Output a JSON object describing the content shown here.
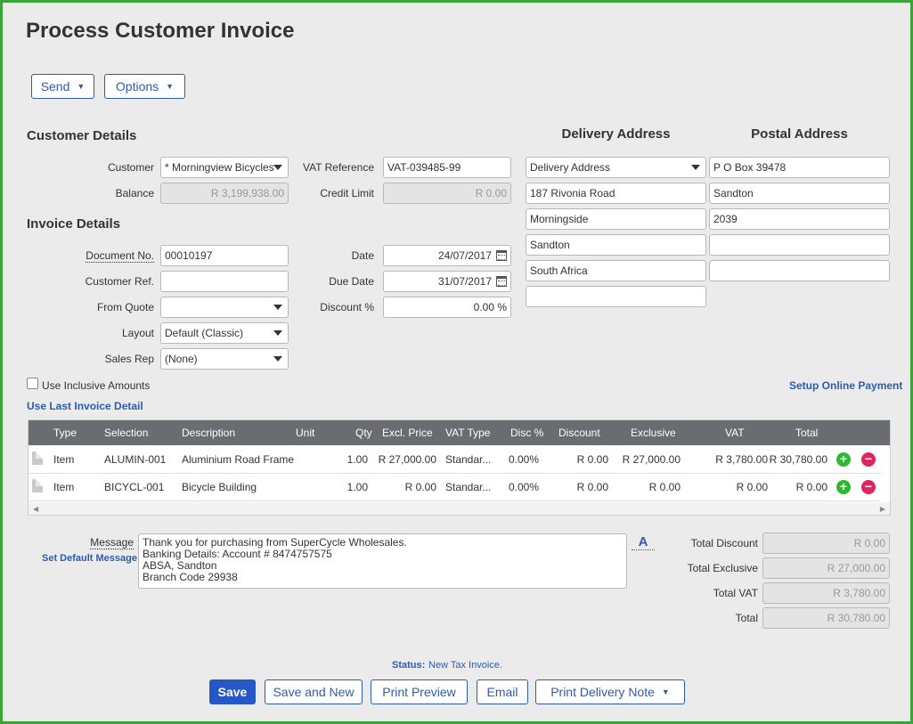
{
  "page": {
    "title": "Process Customer Invoice"
  },
  "toolbar": {
    "send_label": "Send",
    "options_label": "Options"
  },
  "customer_details": {
    "heading": "Customer Details",
    "customer_label": "Customer",
    "customer_value": "* Morningview Bicycles",
    "balance_label": "Balance",
    "balance_value": "R 3,199,938.00",
    "vat_ref_label": "VAT Reference",
    "vat_ref_value": "VAT-039485-99",
    "credit_limit_label": "Credit Limit",
    "credit_limit_value": "R 0.00"
  },
  "invoice_details": {
    "heading": "Invoice Details",
    "doc_no_label": "Document No.",
    "doc_no_value": "00010197",
    "customer_ref_label": "Customer Ref.",
    "customer_ref_value": "",
    "from_quote_label": "From Quote",
    "from_quote_value": "",
    "layout_label": "Layout",
    "layout_value": "Default (Classic)",
    "sales_rep_label": "Sales Rep",
    "sales_rep_value": "(None)",
    "date_label": "Date",
    "date_value": "24/07/2017",
    "due_date_label": "Due Date",
    "due_date_value": "31/07/2017",
    "discount_label": "Discount %",
    "discount_value": "0.00 %"
  },
  "delivery_address": {
    "heading": "Delivery Address",
    "select_value": "Delivery Address",
    "lines": [
      "187 Rivonia Road",
      "Morningside",
      "Sandton",
      "South Africa",
      ""
    ]
  },
  "postal_address": {
    "heading": "Postal Address",
    "lines": [
      "P O Box 39478",
      "Sandton",
      "2039",
      "",
      ""
    ]
  },
  "options": {
    "inclusive_label": "Use Inclusive Amounts",
    "inclusive_checked": false,
    "setup_payment_link": "Setup Online Payment",
    "last_invoice_link": "Use Last Invoice Detail"
  },
  "grid": {
    "columns": [
      "Type",
      "Selection",
      "Description",
      "Unit",
      "Qty",
      "Excl. Price",
      "VAT Type",
      "Disc %",
      "Discount",
      "Exclusive",
      "VAT",
      "Total"
    ],
    "rows": [
      {
        "type": "Item",
        "selection": "ALUMIN-001",
        "description": "Aluminium Road Frame",
        "unit": "",
        "qty": "1.00",
        "excl_price": "R 27,000.00",
        "vat_type": "Standar...",
        "disc_pct": "0.00%",
        "discount": "R 0.00",
        "exclusive": "R 27,000.00",
        "vat": "R 3,780.00",
        "total": "R 30,780.00"
      },
      {
        "type": "Item",
        "selection": "BICYCL-001",
        "description": "Bicycle Building",
        "unit": "",
        "qty": "1.00",
        "excl_price": "R 0.00",
        "vat_type": "Standar...",
        "disc_pct": "0.00%",
        "discount": "R 0.00",
        "exclusive": "R 0.00",
        "vat": "R 0.00",
        "total": "R 0.00"
      }
    ]
  },
  "message": {
    "label": "Message",
    "set_default_link": "Set Default Message",
    "lines": [
      "Thank you for purchasing from SuperCycle Wholesales.",
      "Banking Details:  Account # 8474757575",
      "ABSA, Sandton",
      "Branch Code 29938"
    ],
    "format_button": "A"
  },
  "totals": {
    "total_discount_label": "Total Discount",
    "total_discount_value": "R 0.00",
    "total_exclusive_label": "Total Exclusive",
    "total_exclusive_value": "R 27,000.00",
    "total_vat_label": "Total VAT",
    "total_vat_value": "R 3,780.00",
    "total_label": "Total",
    "total_value": "R 30,780.00"
  },
  "status": {
    "label": "Status:",
    "value": "New Tax Invoice."
  },
  "actions": {
    "save": "Save",
    "save_and_new": "Save and New",
    "print_preview": "Print Preview",
    "email": "Email",
    "print_delivery_note": "Print Delivery Note"
  },
  "colors": {
    "frame": "#3aa33a",
    "accent": "#2458c6",
    "link": "#2d5cae",
    "grid_header": "#696c71",
    "add": "#2eb82e",
    "remove": "#e0245e"
  }
}
